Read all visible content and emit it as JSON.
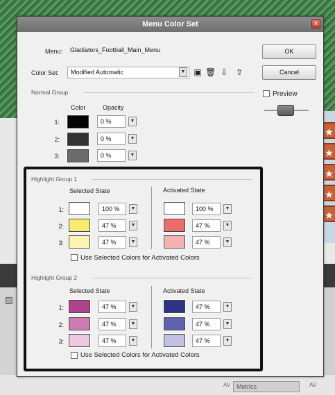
{
  "dialog": {
    "title": "Menu Color Set",
    "menu_label": "Menu:",
    "menu_value": "Gladiators_Football_Main_Menu",
    "color_set_label": "Color Set:",
    "color_set_value": "Modified Automatic",
    "ok_label": "OK",
    "cancel_label": "Cancel",
    "preview_label": "Preview",
    "preview_checked": false,
    "tool_icons": [
      "new-set-icon",
      "delete-set-icon",
      "import-set-icon",
      "export-set-icon"
    ]
  },
  "normal_group": {
    "title": "Normal Group",
    "color_header": "Color",
    "opacity_header": "Opacity",
    "rows": [
      {
        "index": "1:",
        "color": "#050505",
        "opacity": "0 %"
      },
      {
        "index": "2:",
        "color": "#333333",
        "opacity": "0 %"
      },
      {
        "index": "3:",
        "color": "#6b6b6b",
        "opacity": "0 %"
      }
    ]
  },
  "highlight_group_1": {
    "title": "Highlight Group 1",
    "selected_header": "Selected State",
    "activated_header": "Activated State",
    "rows": [
      {
        "index": "1:",
        "sel_color": "#ffffff",
        "sel_opacity": "100 %",
        "act_color": "#ffffff",
        "act_opacity": "100 %"
      },
      {
        "index": "2:",
        "sel_color": "#f7ec6e",
        "sel_opacity": "47 %",
        "act_color": "#ee6b6b",
        "act_opacity": "47 %"
      },
      {
        "index": "3:",
        "sel_color": "#fbf4b2",
        "sel_opacity": "47 %",
        "act_color": "#f5b2b2",
        "act_opacity": "47 %"
      }
    ],
    "use_selected_label": "Use Selected Colors for Activated Colors"
  },
  "highlight_group_2": {
    "title": "Highlight Group 2",
    "selected_header": "Selected State",
    "activated_header": "Activated State",
    "rows": [
      {
        "index": "1:",
        "sel_color": "#b0428e",
        "sel_opacity": "47 %",
        "act_color": "#2e3485",
        "act_opacity": "47 %"
      },
      {
        "index": "2:",
        "sel_color": "#cf7bb2",
        "sel_opacity": "47 %",
        "act_color": "#6162ad",
        "act_opacity": "47 %"
      },
      {
        "index": "3:",
        "sel_color": "#f0c7e1",
        "sel_opacity": "47 %",
        "act_color": "#c2c1e3",
        "act_opacity": "47 %"
      }
    ],
    "use_selected_label": "Use Selected Colors for Activated Colors"
  },
  "background": {
    "metrics_label": "Metrics",
    "av_label": "AV"
  }
}
